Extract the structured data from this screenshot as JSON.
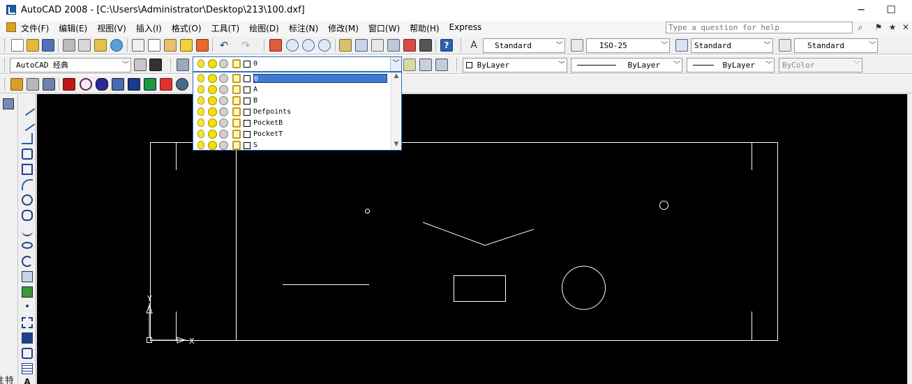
{
  "window": {
    "title": "AutoCAD 2008 - [C:\\Users\\Administrator\\Desktop\\213\\100.dxf]",
    "minimize_glyph": "─",
    "restore_glyph": "☐"
  },
  "menu": {
    "items": [
      "文件(F)",
      "编辑(E)",
      "视图(V)",
      "插入(I)",
      "格式(O)",
      "工具(T)",
      "绘图(D)",
      "标注(N)",
      "修改(M)",
      "窗口(W)",
      "帮助(H)",
      "Express"
    ],
    "help_placeholder": "Type a question for help"
  },
  "styles_toolbar": {
    "text_style": "Standard",
    "dim_style": "ISO-25",
    "table_style": "Standard",
    "multileader_style": "Standard"
  },
  "workspace": {
    "current": "AutoCAD 经典"
  },
  "layers": {
    "current": "0",
    "list": [
      "0",
      "A",
      "B",
      "Defpoints",
      "PocketB",
      "PocketT",
      "S"
    ],
    "selected_index": 0
  },
  "properties_toolbar": {
    "color": "ByLayer",
    "linetype": "ByLayer",
    "lineweight": "ByLayer",
    "plot_style": "ByColor"
  },
  "left_dock": {
    "tab_label": "特性"
  },
  "ucs": {
    "x_label": "X",
    "y_label": "Y"
  },
  "colors": {
    "canvas": "#000000",
    "entity": "#ffffff",
    "selection": "#3d7bd4"
  }
}
